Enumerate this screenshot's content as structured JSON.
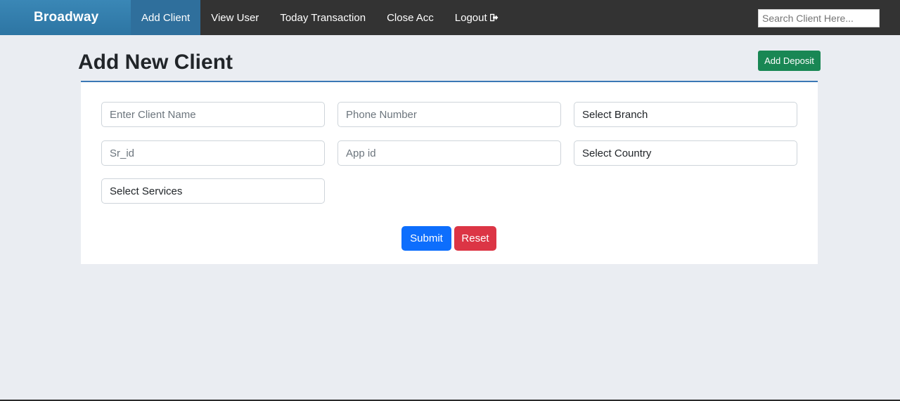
{
  "navbar": {
    "brand": "Broadway",
    "links": [
      {
        "label": "Add Client"
      },
      {
        "label": "View User"
      },
      {
        "label": "Today Transaction"
      },
      {
        "label": "Close Acc"
      },
      {
        "label": "Logout"
      }
    ],
    "search_placeholder": "Search Client Here..."
  },
  "page": {
    "title": "Add New Client",
    "add_deposit_label": "Add Deposit"
  },
  "form": {
    "client_name_placeholder": "Enter Client Name",
    "phone_placeholder": "Phone Number",
    "branch_select": "Select Branch",
    "sr_id_placeholder": "Sr_id",
    "app_id_placeholder": "App id",
    "country_select": "Select Country",
    "services_select": "Select Services",
    "submit_label": "Submit",
    "reset_label": "Reset"
  },
  "colors": {
    "navbar_bg": "#333333",
    "brand_bg": "#2f79a8",
    "submit": "#0d6efd",
    "reset": "#dc3545",
    "add_deposit": "#198754"
  }
}
